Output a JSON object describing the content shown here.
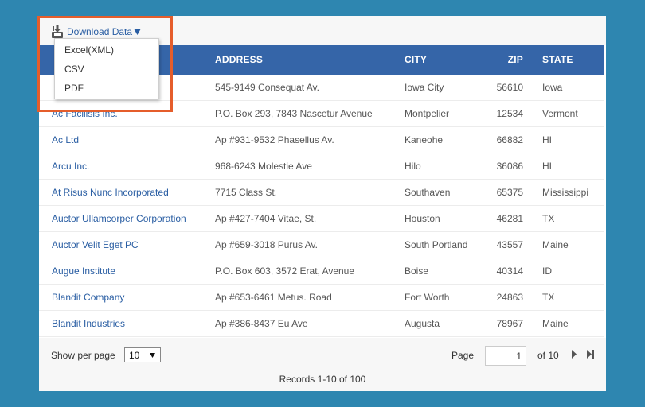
{
  "toolbar": {
    "download_label": "Download Data"
  },
  "menu": {
    "items": [
      "Excel(XML)",
      "CSV",
      "PDF"
    ]
  },
  "columns": [
    "ADDRESS",
    "CITY",
    "ZIP",
    "STATE"
  ],
  "rows": [
    {
      "name": "",
      "address": "545-9149 Consequat Av.",
      "city": "Iowa City",
      "zip": "56610",
      "state": "Iowa"
    },
    {
      "name": "Ac Facilisis Inc.",
      "address": "P.O. Box 293, 7843 Nascetur Avenue",
      "city": "Montpelier",
      "zip": "12534",
      "state": "Vermont"
    },
    {
      "name": "Ac Ltd",
      "address": "Ap #931-9532 Phasellus Av.",
      "city": "Kaneohe",
      "zip": "66882",
      "state": "HI"
    },
    {
      "name": "Arcu Inc.",
      "address": "968-6243 Molestie Ave",
      "city": "Hilo",
      "zip": "36086",
      "state": "HI"
    },
    {
      "name": "At Risus Nunc Incorporated",
      "address": "7715 Class St.",
      "city": "Southaven",
      "zip": "65375",
      "state": "Mississippi"
    },
    {
      "name": "Auctor Ullamcorper Corporation",
      "address": "Ap #427-7404 Vitae, St.",
      "city": "Houston",
      "zip": "46281",
      "state": "TX"
    },
    {
      "name": "Auctor Velit Eget PC",
      "address": "Ap #659-3018 Purus Av.",
      "city": "South Portland",
      "zip": "43557",
      "state": "Maine"
    },
    {
      "name": "Augue Institute",
      "address": "P.O. Box 603, 3572 Erat, Avenue",
      "city": "Boise",
      "zip": "40314",
      "state": "ID"
    },
    {
      "name": "Blandit Company",
      "address": "Ap #653-6461 Metus. Road",
      "city": "Fort Worth",
      "zip": "24863",
      "state": "TX"
    },
    {
      "name": "Blandit Industries",
      "address": "Ap #386-8437 Eu Ave",
      "city": "Augusta",
      "zip": "78967",
      "state": "Maine"
    }
  ],
  "footer": {
    "show_per_page_label": "Show per page",
    "per_page_value": "10",
    "page_label": "Page",
    "page_value": "1",
    "of_label": "of 10",
    "records_label": "Records 1-10 of 100"
  },
  "colors": {
    "background": "#2e86b0",
    "header": "#3565a8",
    "link": "#2a5ea3",
    "highlight": "#e55d2b"
  },
  "icons": [
    "download-icon",
    "caret-down-icon",
    "next-page-icon",
    "last-page-icon"
  ]
}
